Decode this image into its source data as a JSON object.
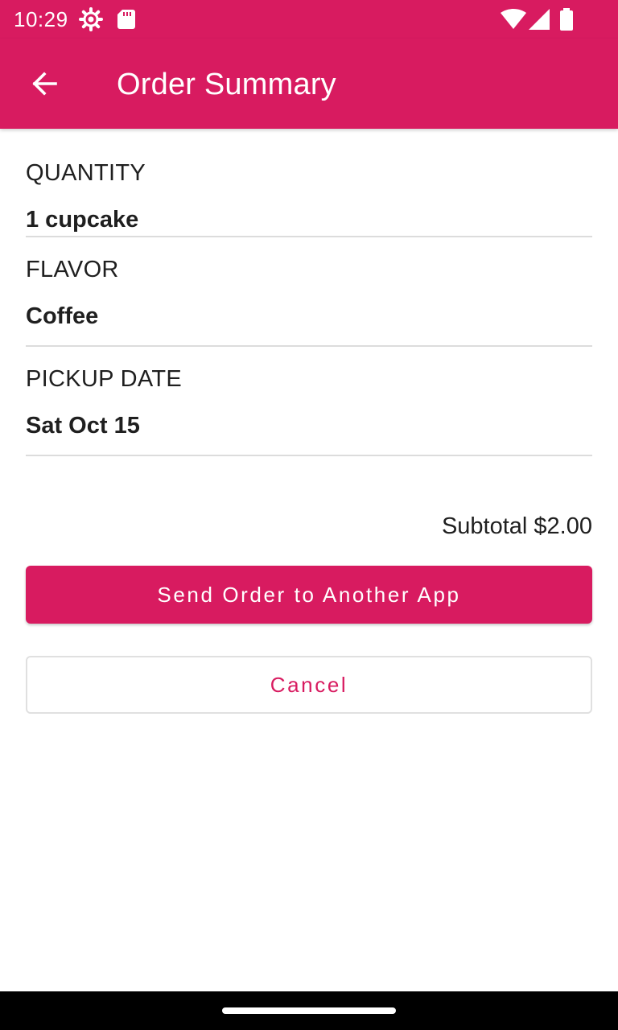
{
  "status_bar": {
    "time": "10:29",
    "icons": [
      "settings-gear-icon",
      "sd-card-icon",
      "wifi-icon",
      "cell-signal-icon",
      "battery-icon"
    ]
  },
  "app_bar": {
    "title": "Order Summary",
    "back_icon": "arrow-back-icon"
  },
  "summary": {
    "rows": [
      {
        "label": "QUANTITY",
        "value": "1 cupcake"
      },
      {
        "label": "FLAVOR",
        "value": "Coffee"
      },
      {
        "label": "PICKUP DATE",
        "value": "Sat Oct 15"
      }
    ],
    "subtotal": "Subtotal $2.00"
  },
  "actions": {
    "send_label": "Send Order to Another App",
    "cancel_label": "Cancel"
  },
  "colors": {
    "primary": "#d81b60",
    "text": "#1f1f1f",
    "divider": "#dcdcdc"
  }
}
